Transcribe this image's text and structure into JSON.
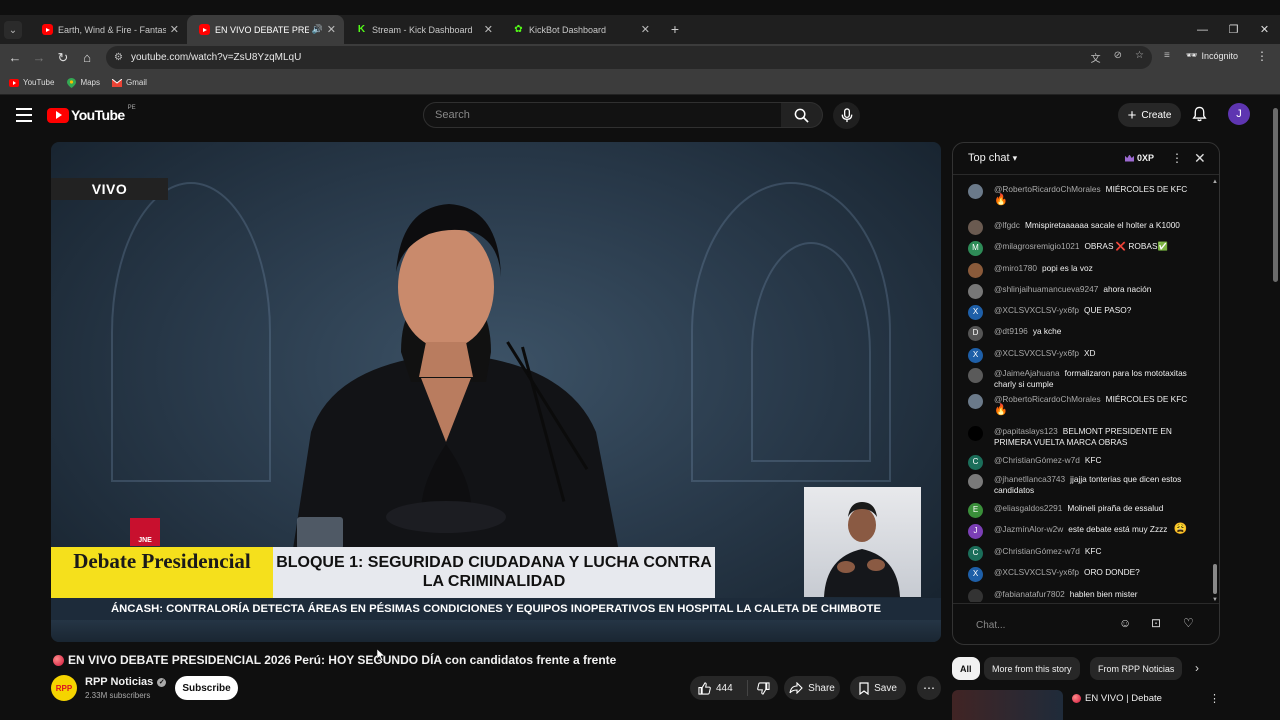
{
  "browser": {
    "tabs": [
      {
        "title": "Earth, Wind & Fire - Fantasy (Of",
        "favicon": "youtube-icon",
        "active": false,
        "audio": false
      },
      {
        "title": "EN VIVO DEBATE PRESID",
        "favicon": "youtube-icon",
        "active": true,
        "audio": true
      },
      {
        "title": "Stream - Kick Dashboard",
        "favicon": "kick-icon",
        "active": false,
        "audio": false
      },
      {
        "title": "KickBot Dashboard",
        "favicon": "kickbot-icon",
        "active": false,
        "audio": false
      }
    ],
    "url": "youtube.com/watch?v=ZsU8YzqMLqU",
    "profile_label": "Incógnito",
    "bookmarks": [
      {
        "label": "YouTube",
        "icon": "youtube-icon"
      },
      {
        "label": "Maps",
        "icon": "maps-icon"
      },
      {
        "label": "Gmail",
        "icon": "gmail-icon"
      }
    ]
  },
  "header": {
    "logo_text": "YouTube",
    "country_code": "PE",
    "search_placeholder": "Search",
    "create_label": "Create",
    "avatar_letter": "J"
  },
  "video": {
    "live_badge": "VIVO",
    "jne_label": "JNE",
    "lower_third_left": "Debate Presidencial",
    "lower_third_right": "BLOQUE 1: SEGURIDAD CIUDADANA Y LUCHA CONTRA LA CRIMINALIDAD",
    "ticker": "ÁNCASH: CONTRALORÍA DETECTA ÁREAS EN PÉSIMAS CONDICIONES Y EQUIPOS INOPERATIVOS EN HOSPITAL LA CALETA DE CHIMBOTE",
    "title": "EN VIVO DEBATE PRESIDENCIAL 2026 Perú: HOY SEGUNDO DÍA con candidatos frente a frente"
  },
  "channel": {
    "name": "RPP Noticias",
    "avatar_text": "RPP",
    "subscribers": "2.33M subscribers",
    "subscribe_label": "Subscribe"
  },
  "actions": {
    "likes": "444",
    "share_label": "Share",
    "save_label": "Save"
  },
  "chat": {
    "mode_label": "Top chat",
    "xp_label": "0XP",
    "input_placeholder": "Chat...",
    "messages": [
      {
        "author": "@RobertoRicardoChMorales",
        "text": "MIÉRCOLES DE KFC",
        "emoji": "🔥",
        "avatar_color": "#6b7a8a",
        "avatar_letter": ""
      },
      {
        "author": "@lfgdc",
        "text": "Mmispiretaaaaaa sacale el holter a K1000",
        "emoji": "",
        "avatar_color": "#6a5a50",
        "avatar_letter": ""
      },
      {
        "author": "@milagrosremigio1021",
        "text": "OBRAS ❌ ROBAS✅",
        "emoji": "",
        "avatar_color": "#2e8b57",
        "avatar_letter": "M"
      },
      {
        "author": "@miro1780",
        "text": "popi es la voz",
        "emoji": "",
        "avatar_color": "#8a5a3a",
        "avatar_letter": ""
      },
      {
        "author": "@shlinjaihuamancueva9247",
        "text": "ahora nación",
        "emoji": "",
        "avatar_color": "#777777",
        "avatar_letter": ""
      },
      {
        "author": "@XCLSVXCLSV-yx6fp",
        "text": "QUE PASO?",
        "emoji": "",
        "avatar_color": "#1e5fa8",
        "avatar_letter": "X"
      },
      {
        "author": "@dt9196",
        "text": "ya kche",
        "emoji": "",
        "avatar_color": "#555555",
        "avatar_letter": "D"
      },
      {
        "author": "@XCLSVXCLSV-yx6fp",
        "text": "XD",
        "emoji": "",
        "avatar_color": "#1e5fa8",
        "avatar_letter": "X"
      },
      {
        "author": "@JaimeAjahuana",
        "text": "formalizaron para los mototaxitas charly si cumple",
        "emoji": "",
        "avatar_color": "#5a5a5a",
        "avatar_letter": ""
      },
      {
        "author": "@RobertoRicardoChMorales",
        "text": "MIÉRCOLES DE KFC",
        "emoji": "🔥",
        "avatar_color": "#6b7a8a",
        "avatar_letter": ""
      },
      {
        "author": "@papitaslays123",
        "text": "BELMONT PRESIDENTE EN PRIMERA VUELTA MARCA OBRAS",
        "emoji": "",
        "avatar_color": "#000000",
        "avatar_letter": ""
      },
      {
        "author": "@ChristianGómez-w7d",
        "text": "KFC",
        "emoji": "",
        "avatar_color": "#1b6e5a",
        "avatar_letter": "C"
      },
      {
        "author": "@jhanetllanca3743",
        "text": "jjajja tonterias que dicen estos candidatos",
        "emoji": "",
        "avatar_color": "#7a7a7a",
        "avatar_letter": ""
      },
      {
        "author": "@eliasgaldos2291",
        "text": "Molineli piraña de essalud",
        "emoji": "",
        "avatar_color": "#3a8f3a",
        "avatar_letter": "E"
      },
      {
        "author": "@JazmínAlor-w2w",
        "text": "este debate está muy Zzzz",
        "emoji": "😩",
        "avatar_color": "#7b3fb5",
        "avatar_letter": "J"
      },
      {
        "author": "@ChristianGómez-w7d",
        "text": "KFC",
        "emoji": "",
        "avatar_color": "#1b6e5a",
        "avatar_letter": "C"
      },
      {
        "author": "@XCLSVXCLSV-yx6fp",
        "text": "ORO DONDE?",
        "emoji": "",
        "avatar_color": "#1e5fa8",
        "avatar_letter": "X"
      },
      {
        "author": "@fabianatafur7802",
        "text": "hablen bien mister",
        "emoji": "",
        "avatar_color": "#333333",
        "avatar_letter": ""
      }
    ]
  },
  "recommendations": {
    "chips": [
      "All",
      "More from this story",
      "From RPP Noticias"
    ],
    "first_title": "EN VIVO | Debate"
  }
}
